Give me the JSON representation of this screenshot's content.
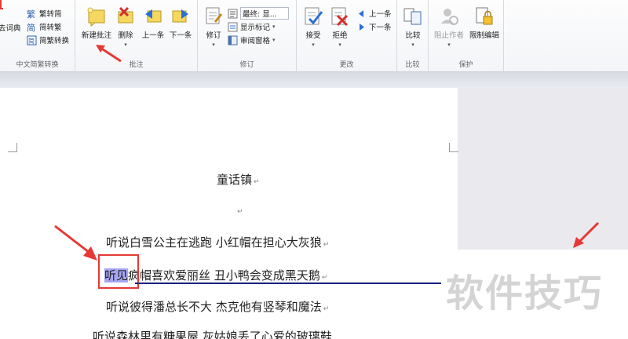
{
  "ribbon": {
    "groups": {
      "chinese": {
        "label": "中文简繁转换",
        "dict_fragment": "去词典",
        "items": [
          "繁转简",
          "简转繁",
          "简繁转换"
        ]
      },
      "comments": {
        "label": "批注",
        "new": "新建批注",
        "delete": "删除",
        "prev": "上一条",
        "next": "下一条"
      },
      "tracking": {
        "label": "修订",
        "track": "修订",
        "display_final": "最终: 显...",
        "show_markup": "显示标记",
        "review_pane": "审阅窗格"
      },
      "changes": {
        "label": "更改",
        "accept": "接受",
        "reject": "拒绝",
        "prev": "上一条",
        "next": "下一条"
      },
      "compare": {
        "label": "比较",
        "compare": "比较"
      },
      "protect": {
        "label": "保护",
        "block_authors": "阻止作者",
        "restrict": "限制编辑"
      }
    }
  },
  "document": {
    "title": "童话镇",
    "lines": [
      "听说白雪公主在逃跑  小红帽在担心大灰狼",
      "听见",
      "疯帽喜欢爱丽丝  丑小鸭会变成黑天鹅",
      "听说彼得潘总长不大  杰克他有竖琴和魔法",
      "听说森林里有糖果屋  灰姑娘丢了心爱的玻璃鞋"
    ],
    "para_mark": "↵",
    "highlight_color": "#a6a6f5",
    "annotation_color": "#e53935",
    "track_line_color": "#1a237e"
  },
  "watermark": "软件技巧"
}
